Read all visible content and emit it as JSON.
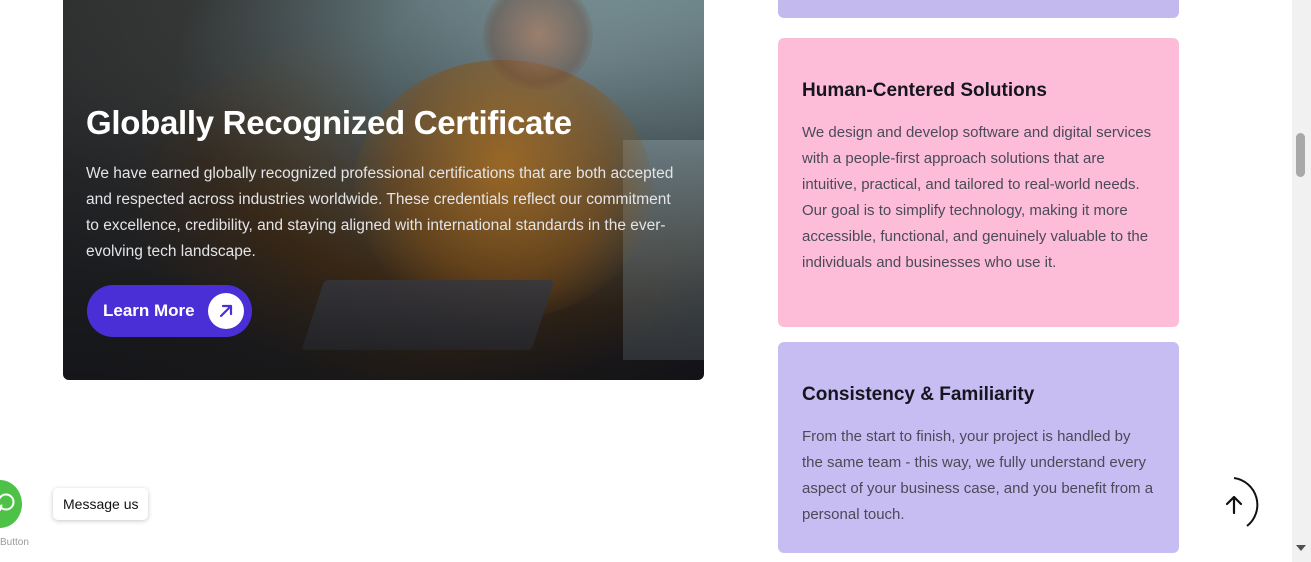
{
  "hero": {
    "title": "Globally Recognized Certificate",
    "description": "We have earned globally recognized professional certifications that are both accepted and respected across industries worldwide. These credentials reflect our commitment to excellence, credibility, and staying aligned with international standards in the ever-evolving tech landscape.",
    "button_label": "Learn More",
    "button_color": "#4b2fd6"
  },
  "cards": [
    {
      "title": "Human-Centered Solutions",
      "text": "We design and develop software and digital services with a people-first approach solutions that are intuitive, practical, and tailored to real-world needs. Our goal is to simplify technology, making it more accessible, functional, and genuinely valuable to the individuals and businesses who use it.",
      "color": "#fdbdd9"
    },
    {
      "title": "Consistency & Familiarity",
      "text": "From the start to finish, your project is handled by the same team - this way, we fully understand every aspect of your business case, and you benefit from a personal touch.",
      "color": "#c8bdf2"
    }
  ],
  "whatsapp": {
    "tooltip": "Message us",
    "caption": "Button",
    "icon": "whatsapp-icon",
    "color": "#4dc247"
  },
  "scroll_top": {
    "icon": "arrow-up-icon"
  }
}
